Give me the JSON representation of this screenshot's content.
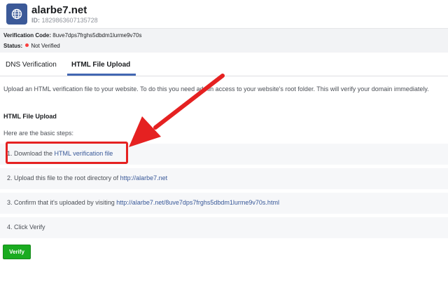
{
  "header": {
    "domain_name": "alarbe7.net",
    "id_label": "ID:",
    "id_value": "1829863607135728",
    "icon": "globe-icon"
  },
  "info": {
    "code_label": "Verification Code:",
    "code_value": "8uve7dps7frghs5dbdm1lurme9v70s",
    "status_label": "Status:",
    "status_value": "Not Verified",
    "status_color": "#fa3e3e"
  },
  "tabs": [
    {
      "label": "DNS Verification",
      "active": false
    },
    {
      "label": "HTML File Upload",
      "active": true
    }
  ],
  "content": {
    "intro": "Upload an HTML verification file to your website. To do this you need admin access to your website's root folder. This will verify your domain immediately.",
    "section_title": "HTML File Upload",
    "steps_label": "Here are the basic steps:",
    "steps": [
      {
        "prefix": "1. Download the ",
        "link": "HTML verification file"
      },
      {
        "prefix": "2. Upload this file to the root directory of ",
        "link": "http://alarbe7.net"
      },
      {
        "prefix": "3. Confirm that it's uploaded by visiting ",
        "link": "http://alarbe7.net/8uve7dps7frghs5dbdm1lurme9v70s.html"
      },
      {
        "prefix": "4. Click Verify",
        "link": ""
      }
    ]
  },
  "verify_button": "Verify",
  "colors": {
    "accent": "#4267b2",
    "link": "#385898",
    "verify": "#1aab20",
    "annotation": "#e52121"
  }
}
